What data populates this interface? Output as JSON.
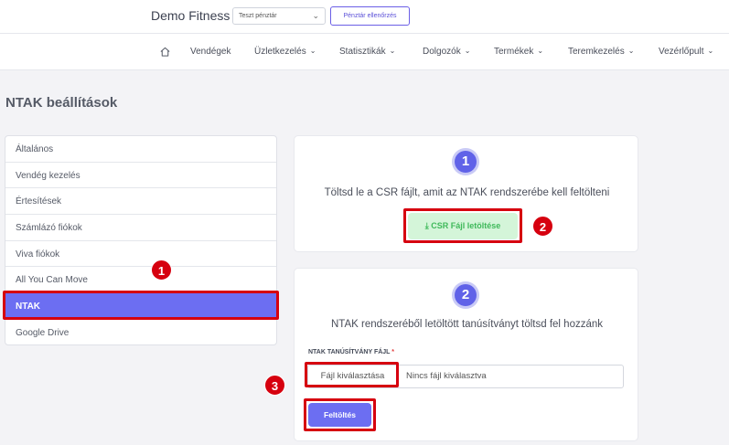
{
  "header": {
    "brand": "Demo Fitness",
    "env_select": "Teszt pénztár",
    "check_button": "Pénztár ellenőrzés"
  },
  "nav": {
    "home_icon": "home-icon",
    "items": [
      {
        "label": "Vendégek",
        "dropdown": false
      },
      {
        "label": "Üzletkezelés",
        "dropdown": true
      },
      {
        "label": "Statisztikák",
        "dropdown": true
      },
      {
        "label": "Dolgozók",
        "dropdown": true
      },
      {
        "label": "Termékek",
        "dropdown": true
      },
      {
        "label": "Teremkezelés",
        "dropdown": true
      },
      {
        "label": "Vezérlőpult",
        "dropdown": true
      }
    ],
    "chevron": "⌄"
  },
  "page": {
    "title": "NTAK beállítások"
  },
  "sidebar": {
    "items": [
      {
        "label": "Általános"
      },
      {
        "label": "Vendég kezelés"
      },
      {
        "label": "Értesítések"
      },
      {
        "label": "Számlázó fiókok"
      },
      {
        "label": "Viva fiókok"
      },
      {
        "label": "All You Can Move"
      },
      {
        "label": "NTAK",
        "active": true
      },
      {
        "label": "Google Drive"
      }
    ]
  },
  "step1": {
    "number": "1",
    "text": "Töltsd le a CSR fájlt, amit az NTAK rendszerébe kell feltölteni",
    "download_icon": "download-icon",
    "download_label": "CSR Fájl letöltése"
  },
  "step2": {
    "number": "2",
    "text": "NTAK rendszeréből letöltött tanúsítványt töltsd fel hozzánk",
    "field_label": "NTAK TANÚSÍTVÁNY FÁJL",
    "required_mark": "*",
    "file_choose": "Fájl kiválasztása",
    "file_none": "Nincs fájl kiválasztva",
    "upload_label": "Feltöltés"
  },
  "annotations": {
    "badges": [
      "1",
      "2",
      "3"
    ],
    "color": "#d6000f"
  },
  "colors": {
    "accent": "#6c6ef2",
    "success_bg": "#d4f5d9",
    "success_text": "#3fb95a"
  }
}
